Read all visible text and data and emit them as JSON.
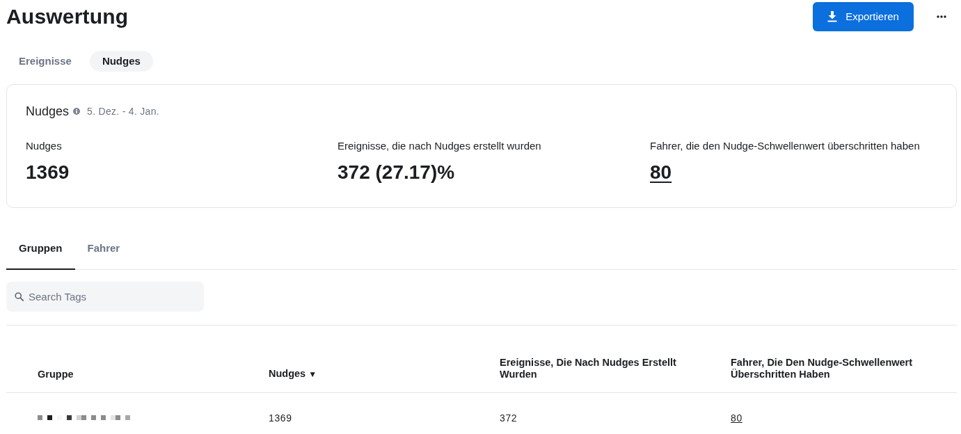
{
  "page": {
    "title": "Auswertung"
  },
  "actions": {
    "export_label": "Exportieren"
  },
  "view_tabs": [
    {
      "label": "Ereignisse",
      "selected": false
    },
    {
      "label": "Nudges",
      "selected": true
    }
  ],
  "summary": {
    "title": "Nudges",
    "date_range": "5. Dez. - 4. Jan.",
    "stats": [
      {
        "label": "Nudges",
        "value": "1369",
        "kind": "plain"
      },
      {
        "label": "Ereignisse, die nach Nudges erstellt wurden",
        "value": "372 (27.17)%",
        "kind": "plain"
      },
      {
        "label": "Fahrer, die den Nudge-Schwellenwert überschritten haben",
        "value": "80",
        "kind": "link"
      }
    ]
  },
  "sub_tabs": [
    {
      "label": "Gruppen",
      "selected": true
    },
    {
      "label": "Fahrer",
      "selected": false
    }
  ],
  "search": {
    "placeholder": "Search Tags"
  },
  "table": {
    "columns": [
      {
        "label": "Gruppe"
      },
      {
        "label": "Nudges",
        "sort_indicator": "▼"
      },
      {
        "label": "Ereignisse, Die Nach Nudges Erstellt Wurden"
      },
      {
        "label": "Fahrer, Die Den Nudge-Schwellenwert Überschritten Haben"
      }
    ],
    "rows": [
      {
        "cells": [
          {
            "kind": "redacted"
          },
          {
            "kind": "text",
            "text": "1369"
          },
          {
            "kind": "text",
            "text": "372"
          },
          {
            "kind": "link",
            "text": "80"
          }
        ]
      }
    ]
  }
}
